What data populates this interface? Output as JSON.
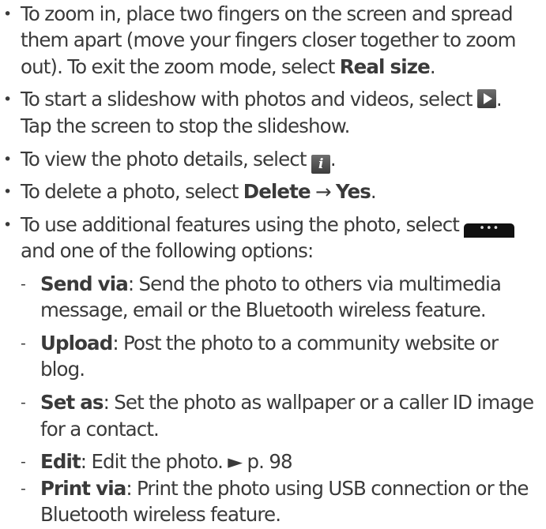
{
  "bullets": {
    "primary": "•",
    "secondary": "-"
  },
  "icons": {
    "play": "play-icon",
    "info": "info-icon",
    "more": "more-options-icon",
    "info_glyph": "i",
    "more_glyph": "•••"
  },
  "zoom": {
    "line1": "To zoom in, place two fingers on the screen and spread",
    "line2": "them apart (move your fingers closer together to zoom",
    "line3_pre": "out). To exit the zoom mode, select ",
    "line3_bold": "Real size",
    "line3_post": "."
  },
  "slideshow": {
    "line1_pre": "To start a slideshow with photos and videos, select ",
    "line1_post": ".",
    "line2": "Tap the screen to stop the slideshow."
  },
  "details": {
    "pre": "To view the photo details, select ",
    "post": "."
  },
  "delete": {
    "pre": "To delete a photo, select ",
    "bold1": "Delete",
    "arrow": " → ",
    "bold2": "Yes",
    "post": "."
  },
  "additional": {
    "line1_pre": "To use additional features using the photo, select ",
    "line2": "and one of the following options:"
  },
  "options": [
    {
      "label": "Send via",
      "lines": [
        ": Send the photo to others via multimedia",
        "message, email or the Bluetooth wireless feature."
      ]
    },
    {
      "label": "Upload",
      "lines": [
        ": Post the photo to a community website or",
        "blog."
      ]
    },
    {
      "label": "Set as",
      "lines": [
        ": Set the photo as wallpaper or a caller ID image",
        "for a contact."
      ]
    },
    {
      "label": "Edit",
      "lines": [
        ": Edit the photo. ► p. 98"
      ]
    },
    {
      "label": "Print via",
      "lines": [
        ": Print the photo using USB connection or the",
        "Bluetooth wireless feature."
      ]
    }
  ]
}
